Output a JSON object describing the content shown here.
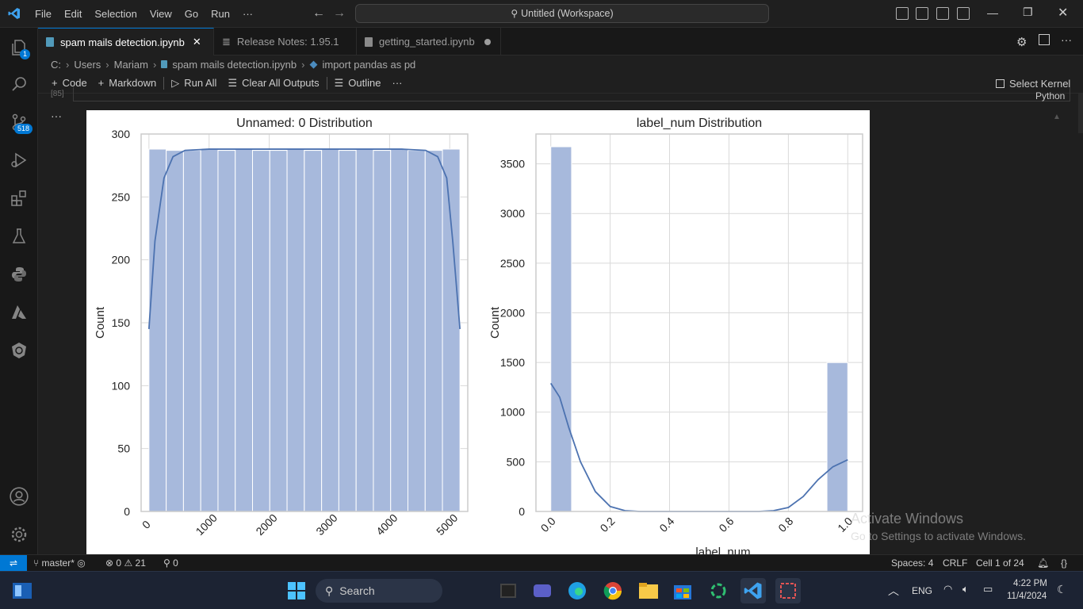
{
  "titlebar": {
    "menu": [
      "File",
      "Edit",
      "Selection",
      "View",
      "Go",
      "Run",
      "···"
    ],
    "search_text": "Untitled (Workspace)"
  },
  "activity_bar": {
    "explorer_badge": "1",
    "scm_badge": "518"
  },
  "tabs": [
    {
      "label": "spam mails detection.ipynb",
      "active": true
    },
    {
      "label": "Release Notes: 1.95.1",
      "active": false
    },
    {
      "label": "getting_started.ipynb",
      "active": false
    }
  ],
  "breadcrumb": [
    "C:",
    "Users",
    "Mariam",
    "spam mails detection.ipynb",
    "import pandas as pd"
  ],
  "nb_toolbar": {
    "code": "Code",
    "markdown": "Markdown",
    "run_all": "Run All",
    "clear": "Clear All Outputs",
    "outline": "Outline",
    "more": "···",
    "kernel": "Select Kernel"
  },
  "cell": {
    "exec_count": "[85]",
    "language": "Python",
    "output_more": "···"
  },
  "chart_data": [
    {
      "type": "bar",
      "title": "Unnamed: 0 Distribution",
      "xlabel": "",
      "ylabel": "Count",
      "xlim": [
        -130,
        5300
      ],
      "ylim": [
        0,
        300
      ],
      "xticks": [
        "0",
        "1000",
        "2000",
        "3000",
        "4000",
        "5000"
      ],
      "yticks": [
        "0",
        "50",
        "100",
        "150",
        "200",
        "250",
        "300"
      ],
      "bins": [
        {
          "x0": 0,
          "x1": 287,
          "count": 288
        },
        {
          "x0": 287,
          "x1": 574,
          "count": 287
        },
        {
          "x0": 574,
          "x1": 861,
          "count": 287
        },
        {
          "x0": 861,
          "x1": 1148,
          "count": 288
        },
        {
          "x0": 1148,
          "x1": 1435,
          "count": 287
        },
        {
          "x0": 1435,
          "x1": 1722,
          "count": 288
        },
        {
          "x0": 1722,
          "x1": 2009,
          "count": 287
        },
        {
          "x0": 2009,
          "x1": 2296,
          "count": 287
        },
        {
          "x0": 2296,
          "x1": 2583,
          "count": 288
        },
        {
          "x0": 2583,
          "x1": 2870,
          "count": 287
        },
        {
          "x0": 2870,
          "x1": 3157,
          "count": 288
        },
        {
          "x0": 3157,
          "x1": 3444,
          "count": 287
        },
        {
          "x0": 3444,
          "x1": 3731,
          "count": 288
        },
        {
          "x0": 3731,
          "x1": 4018,
          "count": 287
        },
        {
          "x0": 4018,
          "x1": 4305,
          "count": 288
        },
        {
          "x0": 4305,
          "x1": 4592,
          "count": 287
        },
        {
          "x0": 4592,
          "x1": 4879,
          "count": 287
        },
        {
          "x0": 4879,
          "x1": 5170,
          "count": 288
        }
      ],
      "kde": {
        "x": [
          0,
          100,
          250,
          400,
          600,
          1000,
          2500,
          4200,
          4600,
          4800,
          4950,
          5050,
          5170
        ],
        "y": [
          145,
          215,
          265,
          282,
          287,
          288,
          288,
          288,
          287,
          282,
          265,
          215,
          145
        ]
      },
      "grid": true,
      "colors": {
        "bar": "#a7b9dc",
        "line": "#4c72b0",
        "grid": "#d9d9d9"
      }
    },
    {
      "type": "bar",
      "title": "label_num Distribution",
      "xlabel": "label_num",
      "ylabel": "Count",
      "xlim": [
        -0.05,
        1.05
      ],
      "ylim": [
        0,
        3800
      ],
      "xticks": [
        "0.0",
        "0.2",
        "0.4",
        "0.6",
        "0.8",
        "1.0"
      ],
      "yticks": [
        "0",
        "500",
        "1000",
        "1500",
        "2000",
        "2500",
        "3000",
        "3500"
      ],
      "bins": [
        {
          "x0": 0.0,
          "x1": 0.07,
          "count": 3672
        },
        {
          "x0": 0.93,
          "x1": 1.0,
          "count": 1499
        }
      ],
      "kde": {
        "x": [
          0,
          0.03,
          0.06,
          0.1,
          0.15,
          0.2,
          0.25,
          0.3,
          0.7,
          0.75,
          0.8,
          0.85,
          0.9,
          0.95,
          1.0
        ],
        "y": [
          1290,
          1150,
          850,
          500,
          200,
          50,
          8,
          0,
          0,
          8,
          40,
          150,
          320,
          450,
          520
        ]
      },
      "grid": true,
      "colors": {
        "bar": "#a7b9dc",
        "line": "#4c72b0",
        "grid": "#d9d9d9"
      }
    }
  ],
  "watermark": {
    "line1": "Activate Windows",
    "line2": "Go to Settings to activate Windows."
  },
  "statusbar": {
    "branch": "master*",
    "errors": "0",
    "warnings": "21",
    "ports": "0",
    "spaces": "Spaces: 4",
    "eol": "CRLF",
    "cell": "Cell 1 of 24"
  },
  "taskbar": {
    "search": "Search",
    "lang": "ENG",
    "time": "4:22 PM",
    "date": "11/4/2024"
  }
}
